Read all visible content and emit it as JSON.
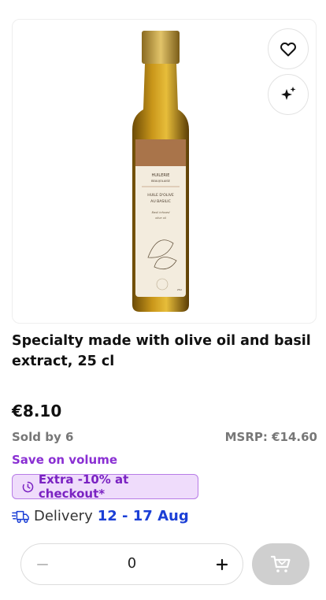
{
  "product": {
    "title": "Specialty made with olive oil and basil extract, 25 cl",
    "price": "€8.10",
    "sold_by": "Sold by 6",
    "msrp": "MSRP: €14.60",
    "save_label": "Save on volume",
    "promo_label": "Extra -10% at checkout*",
    "delivery_label": "Delivery",
    "delivery_dates": "12 - 17 Aug",
    "label_text": {
      "brand": "HUILERIE",
      "brand_sub": "BEAUJOLAISE",
      "name_1": "HUILE D'OLIVE",
      "name_2": "AU BASILIC",
      "desc_1": "Basil infused",
      "desc_2": "olive oil",
      "volume": "25cl"
    }
  },
  "cart": {
    "quantity": "0"
  },
  "colors": {
    "accent_purple": "#8a2fd3",
    "promo_bg": "#efdcfb",
    "delivery_blue": "#1b3fd6",
    "cart_disabled": "#cfcfcf"
  },
  "icons": [
    "heart-icon",
    "sparkle-icon",
    "clock-icon",
    "delivery-truck-icon",
    "minus-icon",
    "plus-icon",
    "cart-icon"
  ]
}
